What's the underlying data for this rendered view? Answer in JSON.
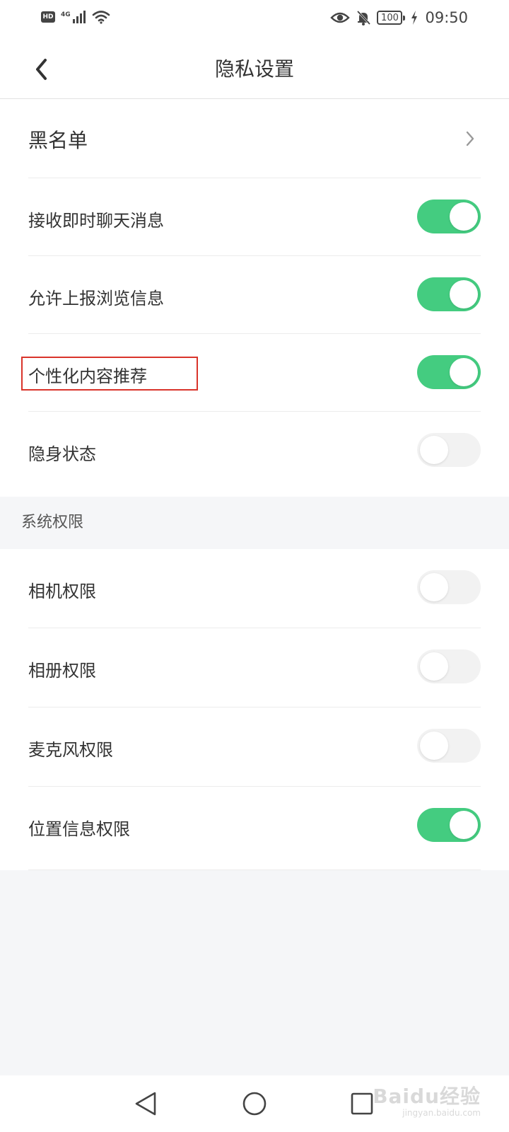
{
  "status_bar": {
    "hd": "HD",
    "network": "4G",
    "battery": "100",
    "time": "09:50"
  },
  "header": {
    "title": "隐私设置"
  },
  "privacy": {
    "blacklist_label": "黑名单",
    "items": [
      {
        "label": "接收即时聊天消息",
        "enabled": true
      },
      {
        "label": "允许上报浏览信息",
        "enabled": true
      },
      {
        "label": "个性化内容推荐",
        "enabled": true
      },
      {
        "label": "隐身状态",
        "enabled": false
      }
    ]
  },
  "system_permissions": {
    "title": "系统权限",
    "items": [
      {
        "label": "相机权限",
        "enabled": false
      },
      {
        "label": "相册权限",
        "enabled": false
      },
      {
        "label": "麦克风权限",
        "enabled": false
      },
      {
        "label": "位置信息权限",
        "enabled": true
      }
    ]
  },
  "colors": {
    "toggle_on": "#44cc80",
    "toggle_off": "#f2f2f2",
    "highlight": "#d9342b"
  },
  "watermark": {
    "main": "Baidu经验",
    "sub": "jingyan.baidu.com"
  }
}
